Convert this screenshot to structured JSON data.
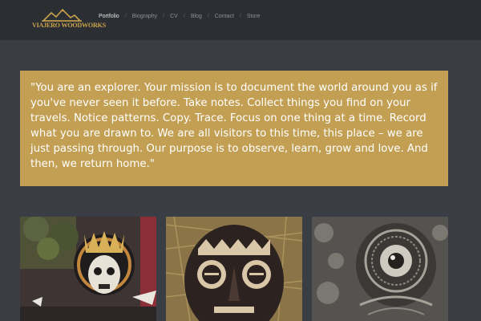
{
  "brand": {
    "logo_text": "VIAJERO WOODWORKS",
    "color": "#c8a24c"
  },
  "nav": {
    "separator": "/",
    "items": [
      {
        "label": "Portfolio",
        "active": true
      },
      {
        "label": "Biography",
        "active": false
      },
      {
        "label": "CV",
        "active": false
      },
      {
        "label": "Blog",
        "active": false
      },
      {
        "label": "Contact",
        "active": false
      },
      {
        "label": "Store",
        "active": false
      }
    ]
  },
  "quote": {
    "text": "\"You are an explorer. Your mission is to document the world around you as if you've never seen it before. Take notes. Collect things you find on your travels. Notice patterns. Copy. Trace. Focus on one thing at a time. Record what you are drawn to. We are all visitors to this time, this place – we are just passing through. Our purpose is to observe, learn, grow and love. And then, we return home.\"",
    "background": "#c29f53"
  },
  "gallery": {
    "items": [
      {
        "name": "skull-mural-tile"
      },
      {
        "name": "mask-tile"
      },
      {
        "name": "eye-drawing-tile"
      }
    ]
  },
  "colors": {
    "page_background": "#3a3d43",
    "header_background": "#2b2e33",
    "nav_text": "#8d9095",
    "nav_active": "#e6e6e6"
  }
}
